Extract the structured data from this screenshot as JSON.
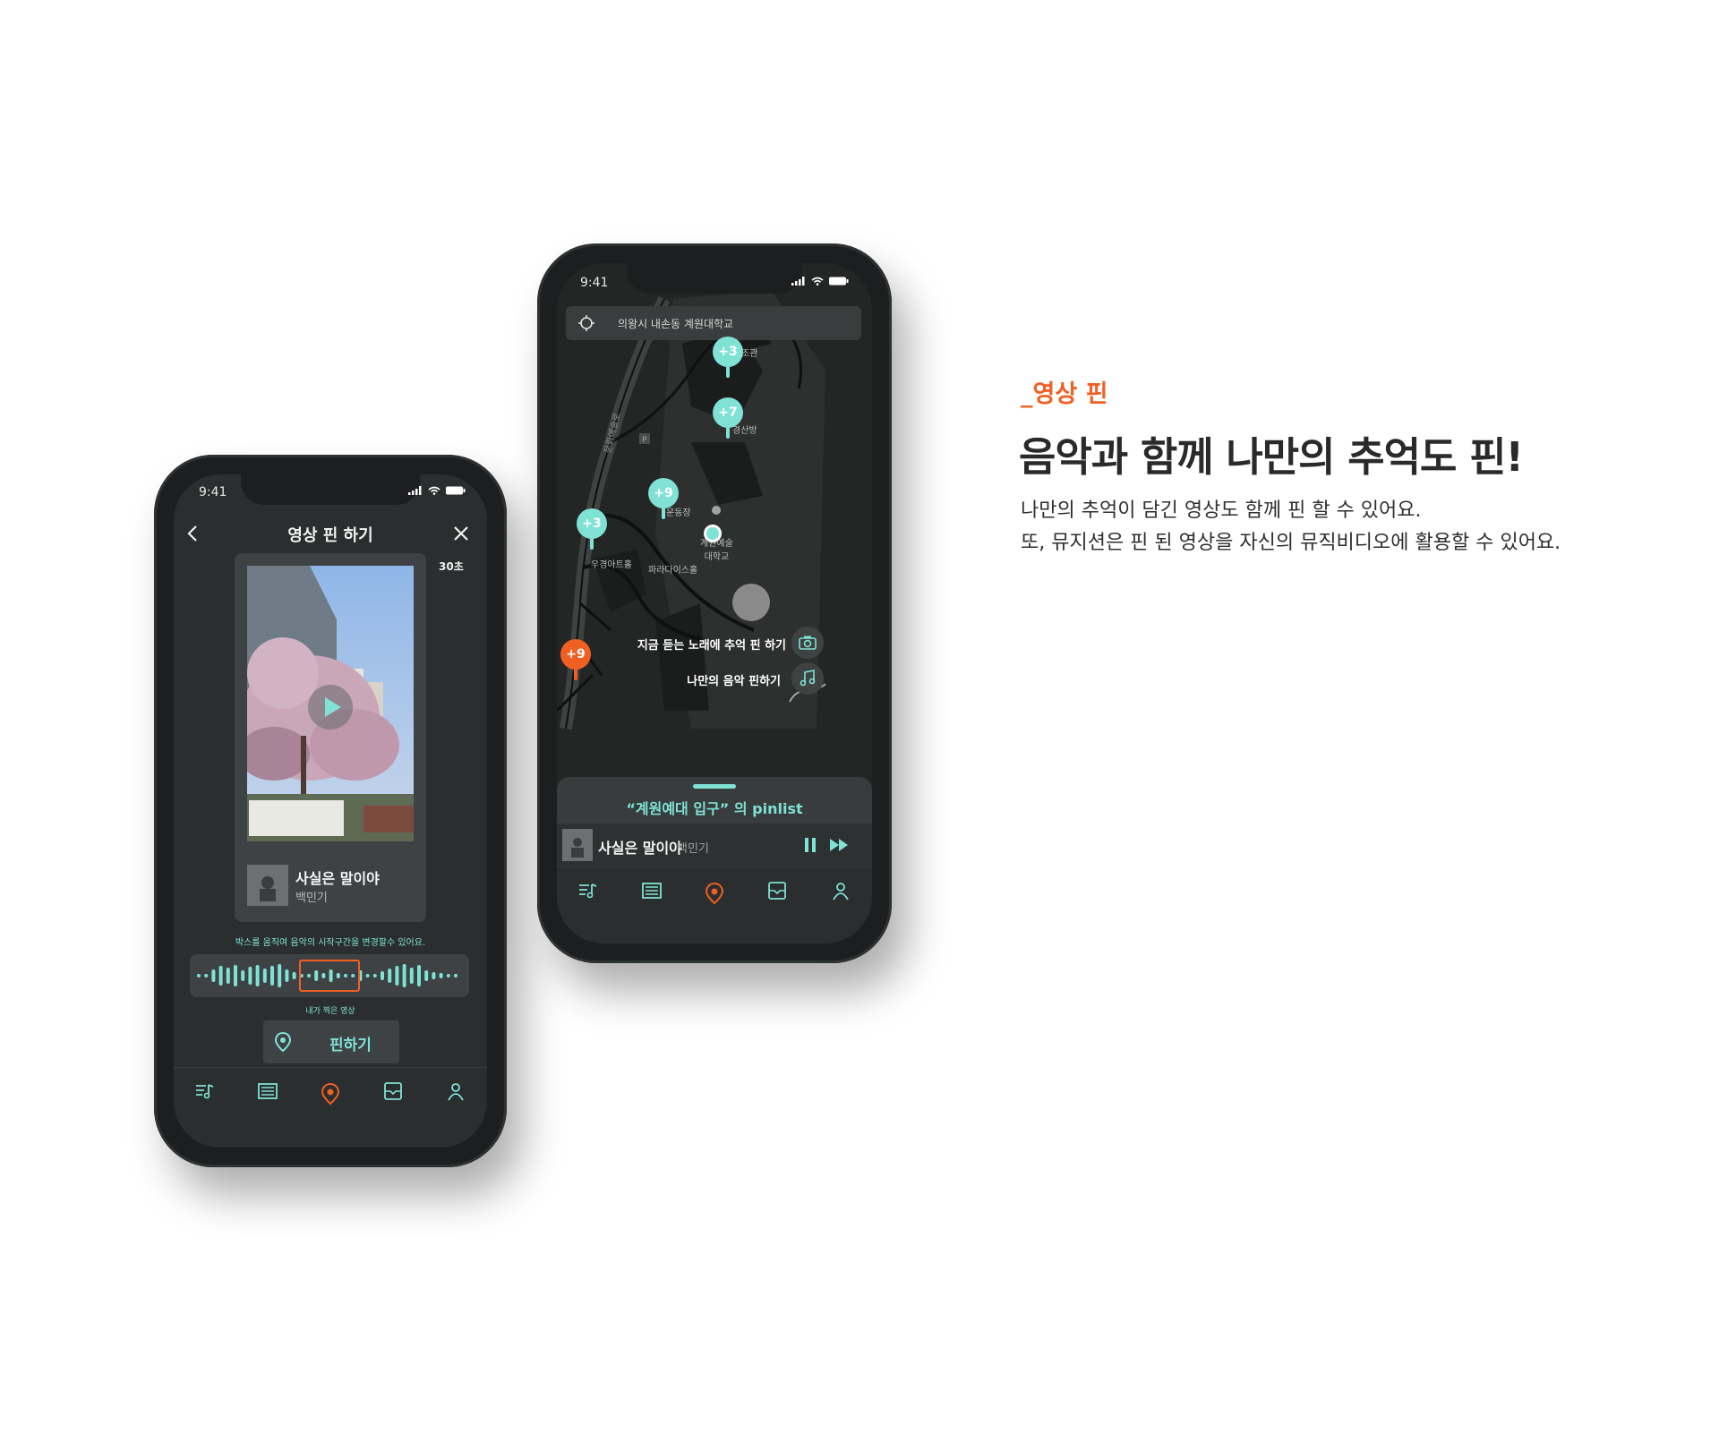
{
  "colors": {
    "accent_mint": "#7fe2d5",
    "accent_orange": "#f06023",
    "phone_body": "#1c1e1f",
    "screen_bg": "#2b2e2f"
  },
  "feature": {
    "tag": "_영상 핀",
    "headline": "음악과 함께 나만의 추억도 핀!",
    "desc_line1": "나만의 추억이 담긴 영상도 함께 핀 할 수 있어요.",
    "desc_line2": "또, 뮤지션은 핀 된 영상을 자신의 뮤직비디오에 활용할 수 있어요."
  },
  "video_pin_screen": {
    "status_time": "9:41",
    "title": "영상 핀 하기",
    "back_icon": "chevron-left-icon",
    "close_icon": "close-icon",
    "duration": "30초",
    "song_title": "사실은 말이야",
    "song_artist": "백민기",
    "hint": "박스를 움직여 음악의 시작구간을 변경할수 있어요.",
    "my_video_label": "내가 찍은 영상",
    "pin_button_label": "핀하기",
    "tabs": [
      "music-list-icon",
      "feed-icon",
      "pin-icon",
      "archive-icon",
      "profile-icon"
    ]
  },
  "map_screen": {
    "status_time": "9:41",
    "search_text": "의왕시 내손동 계원대학교",
    "clusters": [
      {
        "label": "+3",
        "color": "mint"
      },
      {
        "label": "+7",
        "color": "mint"
      },
      {
        "label": "+9",
        "color": "mint"
      },
      {
        "label": "+3",
        "color": "mint"
      },
      {
        "label": "+9",
        "color": "orange"
      }
    ],
    "map_labels": {
      "hall": "조관",
      "gyeongsan": "경산방",
      "field": "운동장",
      "university_l1": "계원예술",
      "university_l2": "대학교",
      "artoma": "우경아트홀",
      "paradise": "파라다이스홀",
      "road": "문화예술로"
    },
    "action_camera": "지금 듣는 노래에 추억 핀 하기",
    "action_music": "나만의 음악 핀하기",
    "pinlist_title": "“계원예대 입구” 의 pinlist",
    "now_playing_title": "사실은 말이야",
    "now_playing_artist": "백민기",
    "tabs": [
      "music-list-icon",
      "feed-icon",
      "pin-icon",
      "archive-icon",
      "profile-icon"
    ]
  }
}
